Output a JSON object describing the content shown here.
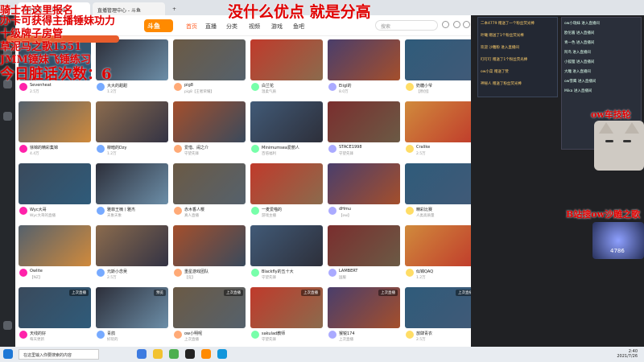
{
  "browser": {
    "tabs": [
      "虎牙直播 - 虎牙游戏",
      "直播管理中心 - 斗鱼"
    ],
    "new_tab": "+"
  },
  "site": {
    "logo": "斗鱼",
    "nav": [
      "首页",
      "直播",
      "分类",
      "视频",
      "游戏",
      "鱼吧"
    ],
    "search_placeholder": "搜索"
  },
  "overlay": {
    "title": "没什么优点 就是分高",
    "left_lines": [
      "骑士在这里报名",
      "办卡可获得主播锤妹功力",
      "十级牌子房管",
      "草泥马之歌1551",
      "JMM锤妹飞锤练习",
      "今日脏话次数：6"
    ],
    "cam_label": "ow车技轮",
    "song_label": "B站搜ow沙雕之歌",
    "badge_value": "4786"
  },
  "cards": [
    {
      "title": "Sevenheat",
      "sub": "2.5万",
      "tag": ""
    },
    {
      "title": "大大的甜甜",
      "sub": "1.2万",
      "tag": ""
    },
    {
      "title": "pig8",
      "sub": "pig8【王者荣耀】",
      "tag": ""
    },
    {
      "title": "白兰花",
      "sub": "温柔气质",
      "tag": ""
    },
    {
      "title": "Eiigl的",
      "sub": "8.0万",
      "tag": ""
    },
    {
      "title": "奶糖小爷",
      "sub": "【原创】",
      "tag": ""
    },
    {
      "title": "ow对战",
      "sub": "守望先锋",
      "tag": ""
    },
    {
      "title": "徐锦的精彩集锦",
      "sub": "4.4万",
      "tag": ""
    },
    {
      "title": "柳暗的Dzy",
      "sub": "1.2万",
      "tag": ""
    },
    {
      "title": "爱惜、闹之介",
      "sub": "守望先锋",
      "tag": ""
    },
    {
      "title": "Minimumsea爱丽人",
      "sub": "百倍福利",
      "tag": ""
    },
    {
      "title": "STACE1998",
      "sub": "守望先锋",
      "tag": ""
    },
    {
      "title": "Cralike",
      "sub": "2.5万",
      "tag": ""
    },
    {
      "title": "ow2ctv",
      "sub": "1.2万",
      "tag": ""
    },
    {
      "title": "Wyc大哥",
      "sub": "Wyc大哥的直播",
      "tag": ""
    },
    {
      "title": "雅菲王楠丨雅杰",
      "sub": "天象天象",
      "tag": ""
    },
    {
      "title": "赤木香人樱",
      "sub": "真人直播",
      "tag": ""
    },
    {
      "title": "一麦爱喵的",
      "sub": "游戏主播",
      "tag": ""
    },
    {
      "title": "dHmu",
      "sub": "【ow】",
      "tag": ""
    },
    {
      "title": "精彩比赛",
      "sub": "人类高质量",
      "tag": ""
    },
    {
      "title": "XINAIF",
      "sub": "2.5万",
      "tag": ""
    },
    {
      "title": "Owlite",
      "sub": "【NZ】",
      "tag": ""
    },
    {
      "title": "元斯小念吴",
      "sub": "2.5万",
      "tag": ""
    },
    {
      "title": "重星游戏团队",
      "sub": "【竞】",
      "tag": ""
    },
    {
      "title": "Blackfly的五十大",
      "sub": "守望先锋",
      "tag": ""
    },
    {
      "title": "LAMBERT",
      "sub": "国服",
      "tag": ""
    },
    {
      "title": "似锦QAQ",
      "sub": "1.2万",
      "tag": ""
    },
    {
      "title": "四两Lyke",
      "sub": "2.5万",
      "tag": ""
    },
    {
      "title": "天线的好",
      "sub": "每天更新",
      "tag": "上次直播"
    },
    {
      "title": "青鸽",
      "sub": "好玩的",
      "tag": "预览"
    },
    {
      "title": "ow小明呢",
      "sub": "上次直播",
      "tag": "上次直播"
    },
    {
      "title": "sakulad教师",
      "sub": "守望先锋",
      "tag": "上次直播"
    },
    {
      "title": "猴锐174",
      "sub": "上次直播",
      "tag": "上次直播"
    },
    {
      "title": "放肆青衣",
      "sub": "2.5万",
      "tag": "上次直播"
    },
    {
      "title": "叫我球宝Ven",
      "sub": "上次直播",
      "tag": "上次直播"
    }
  ],
  "rightpanel": {
    "chat": [
      "二本4779 赠送了一个粉丝荧光棒",
      "叶曦 赠送了1个粉丝荧光棒",
      "欢迎 沙雕粉 进入直播间",
      "叮叮叮 赠送了1个粉丝荧光棒",
      "ow小菜 赠送了赞",
      "神秘人 赠送了粉丝荧光棒"
    ],
    "rank": [
      "ow小瑞妹 进入直播间",
      "欧尼酱 进入直播间",
      "青一色 进入直播间",
      "阿鸟 进入直播间",
      "小狐狸 进入直播间",
      "大雕 进入直播间",
      "ow雪鹰 进入直播间",
      "Mika 进入直播间"
    ]
  },
  "taskbar": {
    "search": "在这里输入你要搜索的内容",
    "time": "2:40",
    "date": "2021/7/26"
  },
  "colors": {
    "brand": "#ff8a00",
    "overlay_red": "#e00000"
  }
}
